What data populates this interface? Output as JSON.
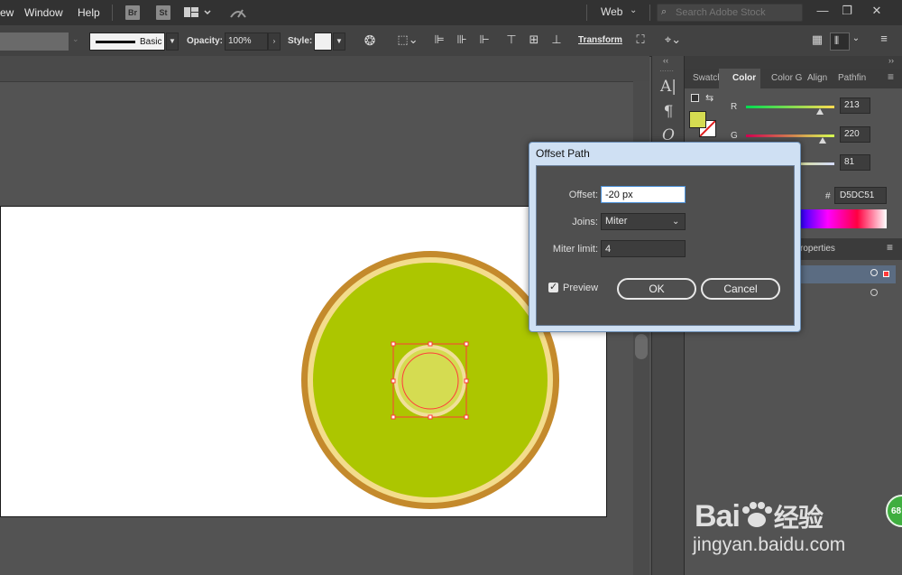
{
  "menu": {
    "items": [
      "ew",
      "Window",
      "Help"
    ],
    "apps": [
      "Br",
      "St"
    ]
  },
  "workspace": {
    "label": "Web"
  },
  "search": {
    "placeholder": "Search Adobe Stock"
  },
  "controlbar": {
    "stroke_style": "Basic",
    "opacity_label": "Opacity:",
    "opacity_value": "100%",
    "style_label": "Style:",
    "transform_label": "Transform"
  },
  "panel": {
    "tabs": [
      "Swatch",
      "Color",
      "Color G",
      "Align",
      "Pathfin"
    ],
    "active_tab": "Color",
    "channels": [
      {
        "name": "R",
        "value": "213",
        "fraction": 0.835
      },
      {
        "name": "G",
        "value": "220",
        "fraction": 0.863
      },
      {
        "name": "B",
        "value": "81",
        "fraction": 0.318
      }
    ],
    "hex_symbol": "#",
    "hex_value": "D5DC51",
    "fill_color": "#d5dc51",
    "properties_tab": "roperties"
  },
  "dialog": {
    "title": "Offset Path",
    "offset_label": "Offset:",
    "offset_value": "-20 px",
    "joins_label": "Joins:",
    "joins_value": "Miter",
    "miter_label": "Miter limit:",
    "miter_value": "4",
    "preview_label": "Preview",
    "preview_checked": true,
    "ok_label": "OK",
    "cancel_label": "Cancel"
  },
  "artwork": {
    "outer_ring_color": "#c48a2c",
    "inner_ring_color": "#f3dc8c",
    "main_fill_color": "#acc600",
    "small_circle_color": "#d5dc51",
    "selection_color": "#ff3a3a"
  },
  "watermark": {
    "logo": "Bai",
    "logo_cn": "经验",
    "url": "jingyan.baidu.com",
    "badge": "68"
  }
}
